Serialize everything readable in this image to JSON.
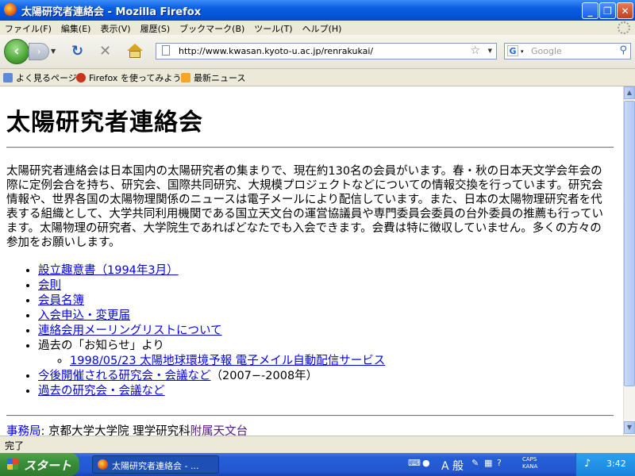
{
  "window": {
    "title": "太陽研究者連絡会 - Mozilla Firefox",
    "minimize": "_",
    "maximize": "❐",
    "close": "✕"
  },
  "menu": [
    "ファイル(F)",
    "編集(E)",
    "表示(V)",
    "履歴(S)",
    "ブックマーク(B)",
    "ツール(T)",
    "ヘルプ(H)"
  ],
  "nav": {
    "url": "http://www.kwasan.kyoto-u.ac.jp/renrakukai/",
    "search_placeholder": "Google",
    "search_engine": "G"
  },
  "bookmarks": [
    "よく見るページ",
    "Firefox を使ってみよう",
    "最新ニュース"
  ],
  "page": {
    "heading": "太陽研究者連絡会",
    "paragraph": "太陽研究者連絡会は日本国内の太陽研究者の集まりで、現在約130名の会員がいます。春・秋の日本天文学会年会の際に定例会合を持ち、研究会、国際共同研究、大規模プロジェクトなどについての情報交換を行っています。研究会情報や、世界各国の太陽物理関係のニュースは電子メールにより配信しています。また、日本の太陽物理研究者を代表する組織として、大学共同利用機関である国立天文台の運営協議員や専門委員会委員の台外委員の推薦も行っています。太陽物理の研究者、大学院生であればどなたでも入会できます。会費は特に徴収していません。多くの方々の参加をお願いします。",
    "links": {
      "prospectus": "設立趣意書（1994年3月）",
      "bylaws": "会則",
      "roster": "会員名簿",
      "membership": "入会申込・変更届",
      "mailing_list": "連絡会用メーリングリストについて",
      "past_notices_label": "過去の「お知らせ」より",
      "notice_1998": "1998/05/23 太陽地球環境予報 電子メイル自動配信サービス",
      "upcoming_meetings": "今後開催される研究会・会議など",
      "upcoming_meetings_note": "（2007−-2008年）",
      "past_meetings": "過去の研究会・会議など"
    },
    "secretariat": {
      "label": "事務局",
      "colon": ":",
      "text": " 京都大学大学院 理学研究科",
      "link": "附属天文台"
    }
  },
  "status": "完了",
  "taskbar": {
    "start": "スタート",
    "task": "太陽研究者連絡会 - ...",
    "ime": "A 般",
    "caps": "CAPS",
    "kana": "KANA",
    "clock": "3:42"
  }
}
